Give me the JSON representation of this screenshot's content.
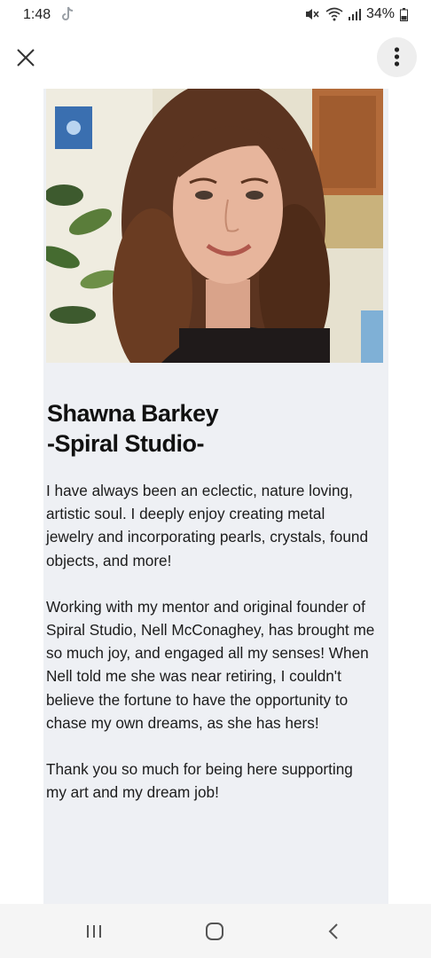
{
  "status_bar": {
    "time": "1:48",
    "battery": "34%",
    "icons": [
      "tiktok-icon",
      "mute-icon",
      "wifi-icon",
      "signal-icon",
      "battery-icon"
    ]
  },
  "top_bar": {
    "close_icon": "close-icon",
    "more_icon": "more-vertical-icon"
  },
  "profile": {
    "photo_alt": "profile-photo",
    "name_line1": "Shawna Barkey",
    "name_line2": "-Spiral Studio-",
    "paragraphs": [
      "I have always been an eclectic, nature loving, artistic soul. I deeply enjoy creating metal jewelry and incorporating pearls, crystals, found objects, and more!",
      "Working with my mentor and original founder of Spiral Studio, Nell McConaghey, has brought me so much joy, and engaged all my senses! When Nell told me she was near retiring, I couldn't believe the fortune to have the opportunity to chase my own dreams, as she has hers!",
      "Thank you so much for being here supporting my art and my dream job!"
    ]
  },
  "nav_bar": {
    "icons": [
      "recent-apps-icon",
      "home-icon",
      "back-icon"
    ]
  },
  "colors": {
    "card_background": "#eef0f4",
    "nav_background": "#f5f5f5"
  }
}
